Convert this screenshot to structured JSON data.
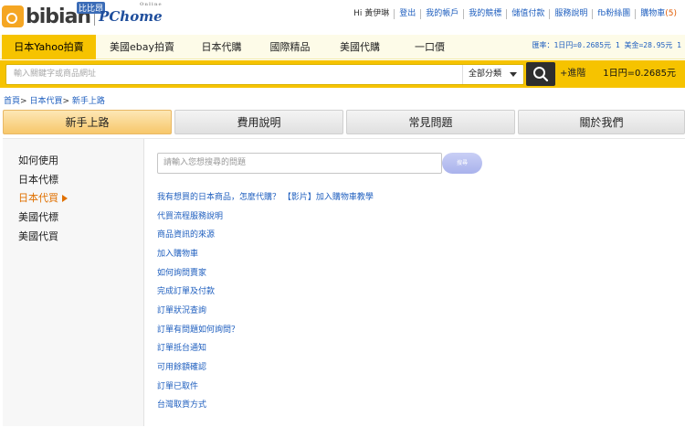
{
  "header": {
    "logo_text": "bibian",
    "logo_badge": "比比昂",
    "partner": "PChome",
    "partner_sub": "Online",
    "greeting": "Hi 黃伊琳",
    "links": [
      "登出",
      "我的帳戶",
      "我的競標",
      "儲值付款",
      "服務說明",
      "fb粉絲團"
    ],
    "cart_label": "購物車",
    "cart_count": "(5)"
  },
  "nav": {
    "tabs": [
      "日本Yahoo拍賣",
      "美國ebay拍賣",
      "日本代購",
      "國際精品",
      "美國代購",
      "一口價"
    ],
    "rate_text": "匯率：1日円=0.2685元  1 美金=28.95元 1"
  },
  "search": {
    "placeholder": "輸入關鍵字或商品網址",
    "category": "全部分類",
    "advanced": "+進階",
    "rate": "1日円=0.2685元"
  },
  "breadcrumb": {
    "home": "首頁",
    "level1": "日本代買",
    "level2": "新手上路",
    "sep": ">"
  },
  "tabs": [
    "新手上路",
    "費用說明",
    "常見問題",
    "關於我們"
  ],
  "sidebar": {
    "items": [
      "如何使用",
      "日本代標",
      "日本代買",
      "美國代標",
      "美國代買"
    ]
  },
  "faq": {
    "placeholder": "請輸入您想搜尋的問題",
    "button": "搜尋",
    "links": [
      "我有想買的日本商品，怎麼代購？ 【影片】加入購物車教學",
      "代買流程服務說明",
      "商品資訊的來源",
      "加入購物車",
      "如何詢問賣家",
      "完成訂單及付款",
      "訂單狀況查詢",
      "訂單有問題如何詢問？",
      "訂單抵台通知",
      "可用餘額確認",
      "訂單已取件",
      "台灣取貨方式"
    ]
  },
  "colors": {
    "accent_yellow": "#f6c300",
    "link_blue": "#1f5fbf",
    "active_orange": "#e07000"
  },
  "icons": [
    "logo-box-icon",
    "search-icon",
    "caret-down-icon",
    "arrow-right-icon"
  ]
}
